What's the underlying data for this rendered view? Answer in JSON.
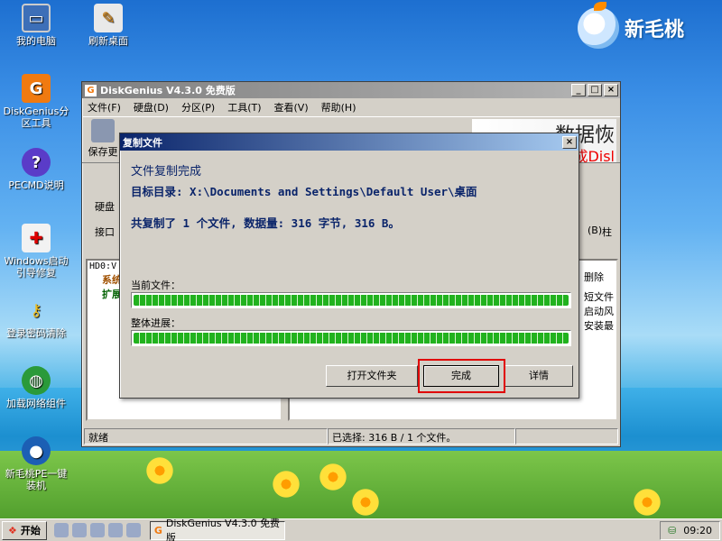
{
  "desktop": {
    "icons": [
      {
        "label": "我的电脑"
      },
      {
        "label": "刷新桌面"
      },
      {
        "label": "DiskGenius分区工具"
      },
      {
        "label": "PECMD说明"
      },
      {
        "label": "Windows启动引导修复"
      },
      {
        "label": "登录密码清除"
      },
      {
        "label": "加载网络组件"
      },
      {
        "label": "新毛桃PE一键装机"
      }
    ],
    "logo": "新毛桃"
  },
  "app": {
    "title": "DiskGenius V4.3.0 免费版",
    "menu": [
      "文件(F)",
      "硬盘(D)",
      "分区(P)",
      "工具(T)",
      "查看(V)",
      "帮助(H)"
    ],
    "toolbar_save": "保存更",
    "banner_text": "数据恢",
    "banner_red": "成Disl",
    "left_labels": [
      "硬盘",
      "接口"
    ],
    "tree": [
      "HD0:V",
      "系统",
      "扩展"
    ],
    "right_labels": [
      "(B)",
      "柱",
      "删除",
      "短文件",
      "启动风",
      "安装最"
    ],
    "status_left": "就绪",
    "status_mid": "已选择: 316 B / 1 个文件。"
  },
  "dialog": {
    "title": "复制文件",
    "line1": "文件复制完成",
    "line2": "目标目录: X:\\Documents and Settings\\Default User\\桌面",
    "line3": "共复制了 1 个文件, 数据量: 316 字节, 316 B。",
    "current_label": "当前文件：",
    "overall_label": "整体进展：",
    "current_progress": 1.0,
    "overall_progress": 1.0,
    "btn_open": "打开文件夹",
    "btn_done": "完成",
    "btn_detail": "详情"
  },
  "taskbar": {
    "start": "开始",
    "task": "DiskGenius V4.3.0 免费版",
    "time": "09:20"
  }
}
